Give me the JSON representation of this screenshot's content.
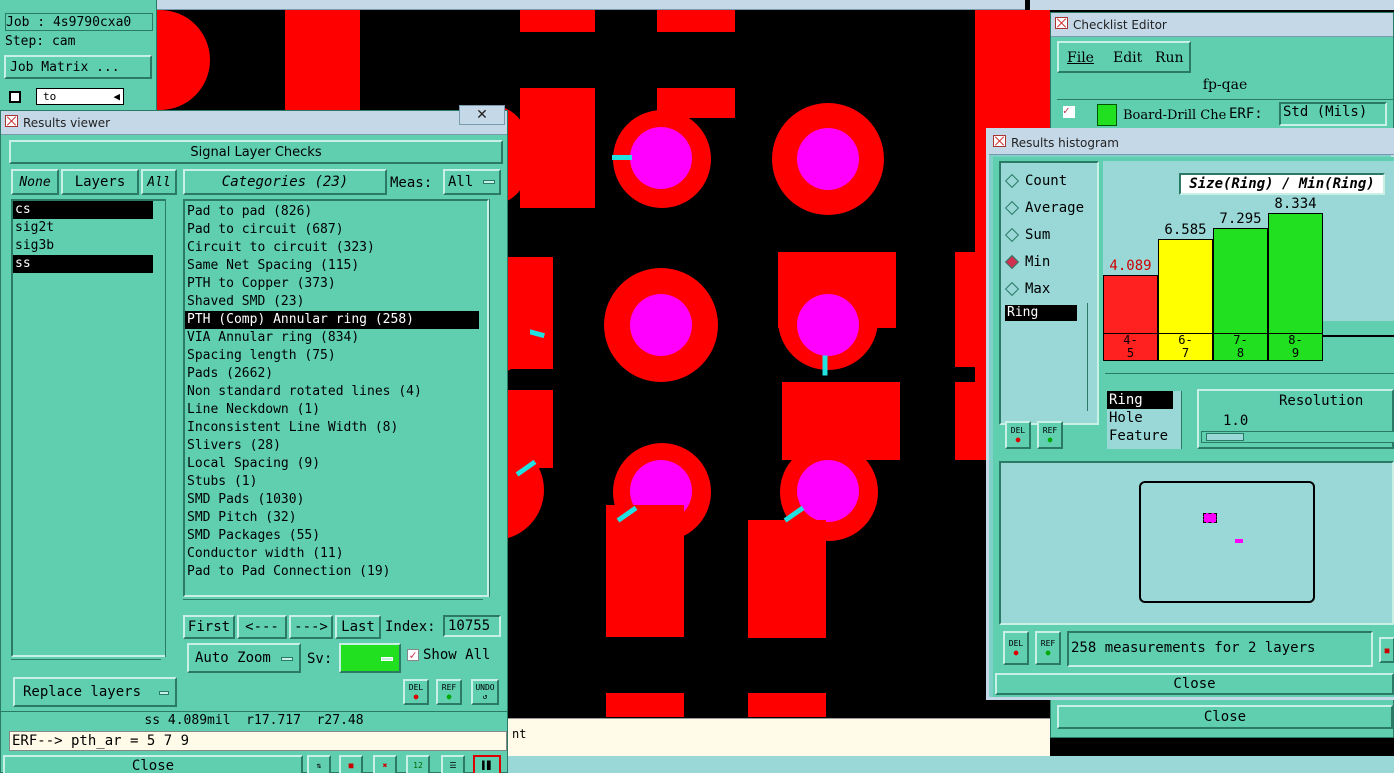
{
  "top_panel": {
    "job": "Job : 4s9790cxa0",
    "step": "Step: cam",
    "job_matrix": "Job Matrix ...",
    "to_field": "to"
  },
  "results_viewer": {
    "title": "Results viewer",
    "header": "Signal Layer Checks",
    "none_btn": "None",
    "layers_btn": "Layers",
    "all_btn": "All",
    "categories_btn": "Categories (23)",
    "meas_label": "Meas:",
    "meas_value": "All",
    "layers": [
      {
        "name": "cs",
        "selected": true
      },
      {
        "name": "sig2t",
        "selected": false
      },
      {
        "name": "sig3b",
        "selected": false
      },
      {
        "name": "ss",
        "selected": true
      }
    ],
    "categories": [
      {
        "label": "Pad to pad (826)",
        "selected": false
      },
      {
        "label": "Pad to circuit (687)",
        "selected": false
      },
      {
        "label": "Circuit to circuit (323)",
        "selected": false
      },
      {
        "label": "Same Net Spacing (115)",
        "selected": false
      },
      {
        "label": "PTH to Copper (373)",
        "selected": false
      },
      {
        "label": "Shaved SMD (23)",
        "selected": false
      },
      {
        "label": "PTH (Comp) Annular ring (258)",
        "selected": true
      },
      {
        "label": "VIA Annular ring (834)",
        "selected": false
      },
      {
        "label": "Spacing length (75)",
        "selected": false
      },
      {
        "label": "Pads (2662)",
        "selected": false
      },
      {
        "label": "Non standard rotated lines (4)",
        "selected": false
      },
      {
        "label": "Line Neckdown (1)",
        "selected": false
      },
      {
        "label": "Inconsistent Line Width (8)",
        "selected": false
      },
      {
        "label": "Slivers (28)",
        "selected": false
      },
      {
        "label": "Local Spacing (9)",
        "selected": false
      },
      {
        "label": "Stubs (1)",
        "selected": false
      },
      {
        "label": "SMD Pads (1030)",
        "selected": false
      },
      {
        "label": "SMD Pitch (32)",
        "selected": false
      },
      {
        "label": "SMD Packages (55)",
        "selected": false
      },
      {
        "label": "Conductor width (11)",
        "selected": false
      },
      {
        "label": "Pad to Pad Connection (19)",
        "selected": false
      }
    ],
    "first_btn": "First",
    "prev_btn": "<---",
    "next_btn": "--->",
    "last_btn": "Last",
    "index_label": "Index:",
    "index_value": "10755",
    "auto_zoom": "Auto Zoom",
    "sv_label": "Sv:",
    "show_all": "Show All",
    "replace_layers": "Replace layers",
    "del_icon": "DEL",
    "ref_icon": "REF",
    "undo_icon": "UNDO",
    "status": "ss 4.089mil  r17.717  r27.48",
    "erf_line": "ERF--> pth_ar = 5 7 9",
    "close": "Close"
  },
  "checklist_editor": {
    "title": "Checklist Editor",
    "menu": [
      "File",
      "Edit",
      "Run"
    ],
    "name": "fp-qae",
    "row_label": "Board-Drill Che",
    "erf_label": "ERF:",
    "erf_value": "Std (Mils)",
    "close": "Close"
  },
  "histogram": {
    "title": "Results histogram",
    "modes": [
      {
        "label": "Count",
        "on": false
      },
      {
        "label": "Average",
        "on": false
      },
      {
        "label": "Sum",
        "on": false
      },
      {
        "label": "Min",
        "on": true
      },
      {
        "label": "Max",
        "on": false
      }
    ],
    "list_item": "Ring",
    "chart_title": "Size(Ring) / Min(Ring)",
    "bars": [
      {
        "value": "4.089",
        "range": "4-\n5",
        "color": "#ff2020",
        "label_color": "#d00000",
        "fraction": 0.49
      },
      {
        "value": "6.585",
        "range": "6-\n7",
        "color": "#ffff00",
        "label_color": "#000000",
        "fraction": 0.79
      },
      {
        "value": "7.295",
        "range": "7-\n8",
        "color": "#20e020",
        "label_color": "#000000",
        "fraction": 0.875
      },
      {
        "value": "8.334",
        "range": "8-\n9",
        "color": "#20e020",
        "label_color": "#000000",
        "fraction": 1.0
      }
    ],
    "features": [
      {
        "label": "Ring",
        "selected": true
      },
      {
        "label": "Hole",
        "selected": false
      },
      {
        "label": "Feature",
        "selected": false
      }
    ],
    "resolution_label": "Resolution",
    "resolution_value": "1.0",
    "del_icon": "DEL",
    "ref_icon": "REF",
    "summary": "258 measurements for 2 layers",
    "close": "Close"
  },
  "bg_text": {
    "nt": "nt"
  }
}
